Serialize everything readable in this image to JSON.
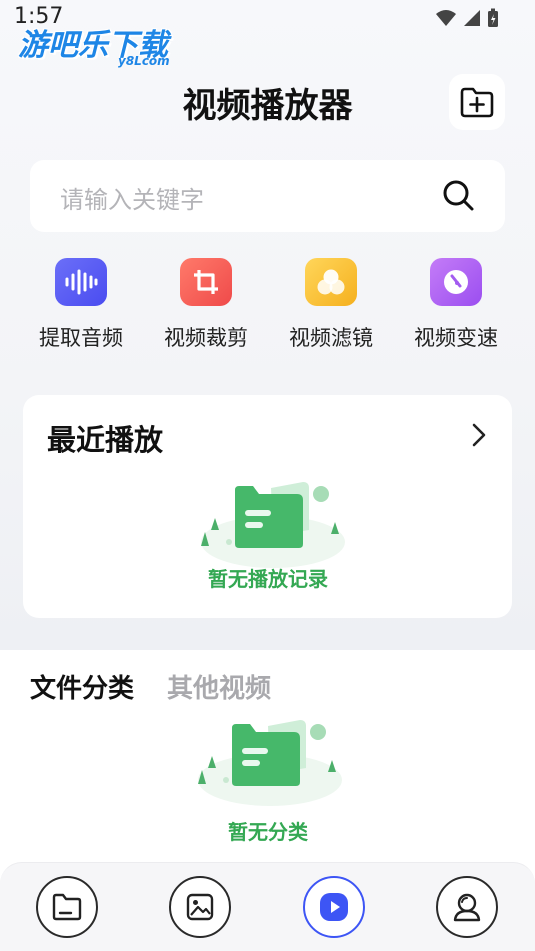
{
  "status_bar": {
    "time": "1:57"
  },
  "watermark": {
    "text": "游吧乐下载",
    "sub": "y8Lcom"
  },
  "header": {
    "title": "视频播放器"
  },
  "search": {
    "placeholder": "请输入关键字"
  },
  "tools": [
    {
      "label": "提取音频",
      "icon": "audio-wave-icon",
      "color": "#5a5cf6"
    },
    {
      "label": "视频裁剪",
      "icon": "crop-icon",
      "color": "#f25757"
    },
    {
      "label": "视频滤镜",
      "icon": "filter-icon",
      "color": "#f7c12e"
    },
    {
      "label": "视频变速",
      "icon": "speed-icon",
      "color": "#a35cf0"
    }
  ],
  "recent": {
    "title": "最近播放",
    "empty_text": "暂无播放记录"
  },
  "categories": {
    "tabs": [
      "文件分类",
      "其他视频"
    ],
    "empty_text": "暂无分类"
  },
  "bottom_nav": [
    {
      "icon": "folder-icon",
      "active": false
    },
    {
      "icon": "image-icon",
      "active": false
    },
    {
      "icon": "play-icon",
      "active": true
    },
    {
      "icon": "profile-icon",
      "active": false
    }
  ],
  "colors": {
    "accent": "#3d55f5",
    "empty_green": "#34a853"
  }
}
